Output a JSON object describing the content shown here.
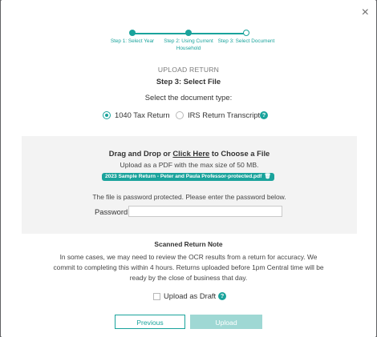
{
  "modal": {
    "close_label": "×"
  },
  "stepper": {
    "steps": [
      {
        "label": "Step 1: Select Year",
        "state": "done"
      },
      {
        "label": "Step 2: Using Current Household",
        "state": "done"
      },
      {
        "label": "Step 3: Select Document",
        "state": "current"
      }
    ]
  },
  "header": {
    "kicker": "UPLOAD RETURN",
    "title": "Step 3: Select File",
    "prompt": "Select the document type:"
  },
  "doc_type": {
    "options": [
      {
        "label": "1040 Tax Return",
        "selected": true
      },
      {
        "label": "IRS Return Transcript",
        "selected": false
      }
    ],
    "help_icon": "?"
  },
  "dropzone": {
    "title_before": "Drag and Drop or ",
    "title_link": "Click Here",
    "title_after": " to Choose a File",
    "subtitle": "Upload as a PDF with the max size of 50 MB.",
    "file_name": "2023 Sample Return - Peter and Paula Professor-protected.pdf",
    "password_note": "The file is password protected. Please enter the password below.",
    "password_label": "Password",
    "password_value": ""
  },
  "note": {
    "title": "Scanned Return Note",
    "body": "In some cases, we may need to review the OCR results from a return for accuracy. We commit to completing this within 4 hours. Returns uploaded before 1pm Central time will be ready by the close of business that day."
  },
  "draft": {
    "label": "Upload as Draft",
    "checked": false,
    "help_icon": "?"
  },
  "buttons": {
    "previous": "Previous",
    "upload": "Upload"
  },
  "colors": {
    "accent": "#1aa39c",
    "accent_disabled": "#9fd8d4",
    "backdrop": "#5f6063",
    "panel": "#f3f3f3"
  }
}
